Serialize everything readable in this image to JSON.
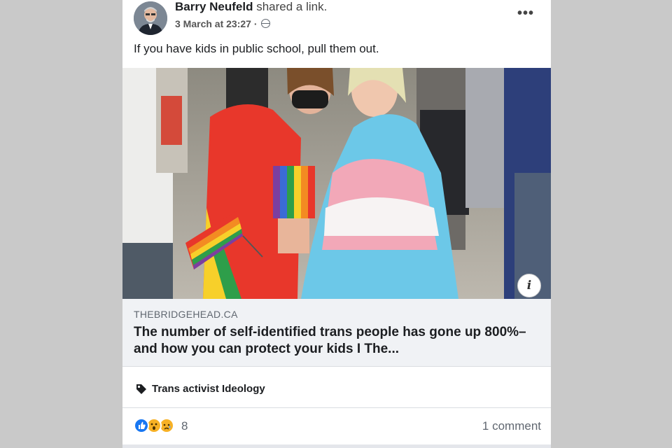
{
  "post": {
    "author_name": "Barry Neufeld",
    "action_text": "shared a link.",
    "timestamp": "3 March at 23:27",
    "separator": "·",
    "privacy_icon": "globe-icon",
    "more_menu": "•••",
    "body_text": "If you have kids in public school, pull them out."
  },
  "link_preview": {
    "domain": "THEBRIDGEHEAD.CA",
    "title": "The number of self-identified trans people has gone up 800%–and how you can protect your kids I The...",
    "info_glyph": "i"
  },
  "tag": {
    "icon": "tag-icon",
    "label": "Trans activist Ideology"
  },
  "engagement": {
    "reaction_icons": [
      "like-icon",
      "wow-icon",
      "sad-icon"
    ],
    "reaction_count": "8",
    "comment_count": "1 comment"
  },
  "colors": {
    "like_blue": "#1877f2",
    "emoji_yellow": "#f7b125",
    "link_box_bg": "#f0f2f5",
    "page_bg": "#c9c9c9"
  }
}
